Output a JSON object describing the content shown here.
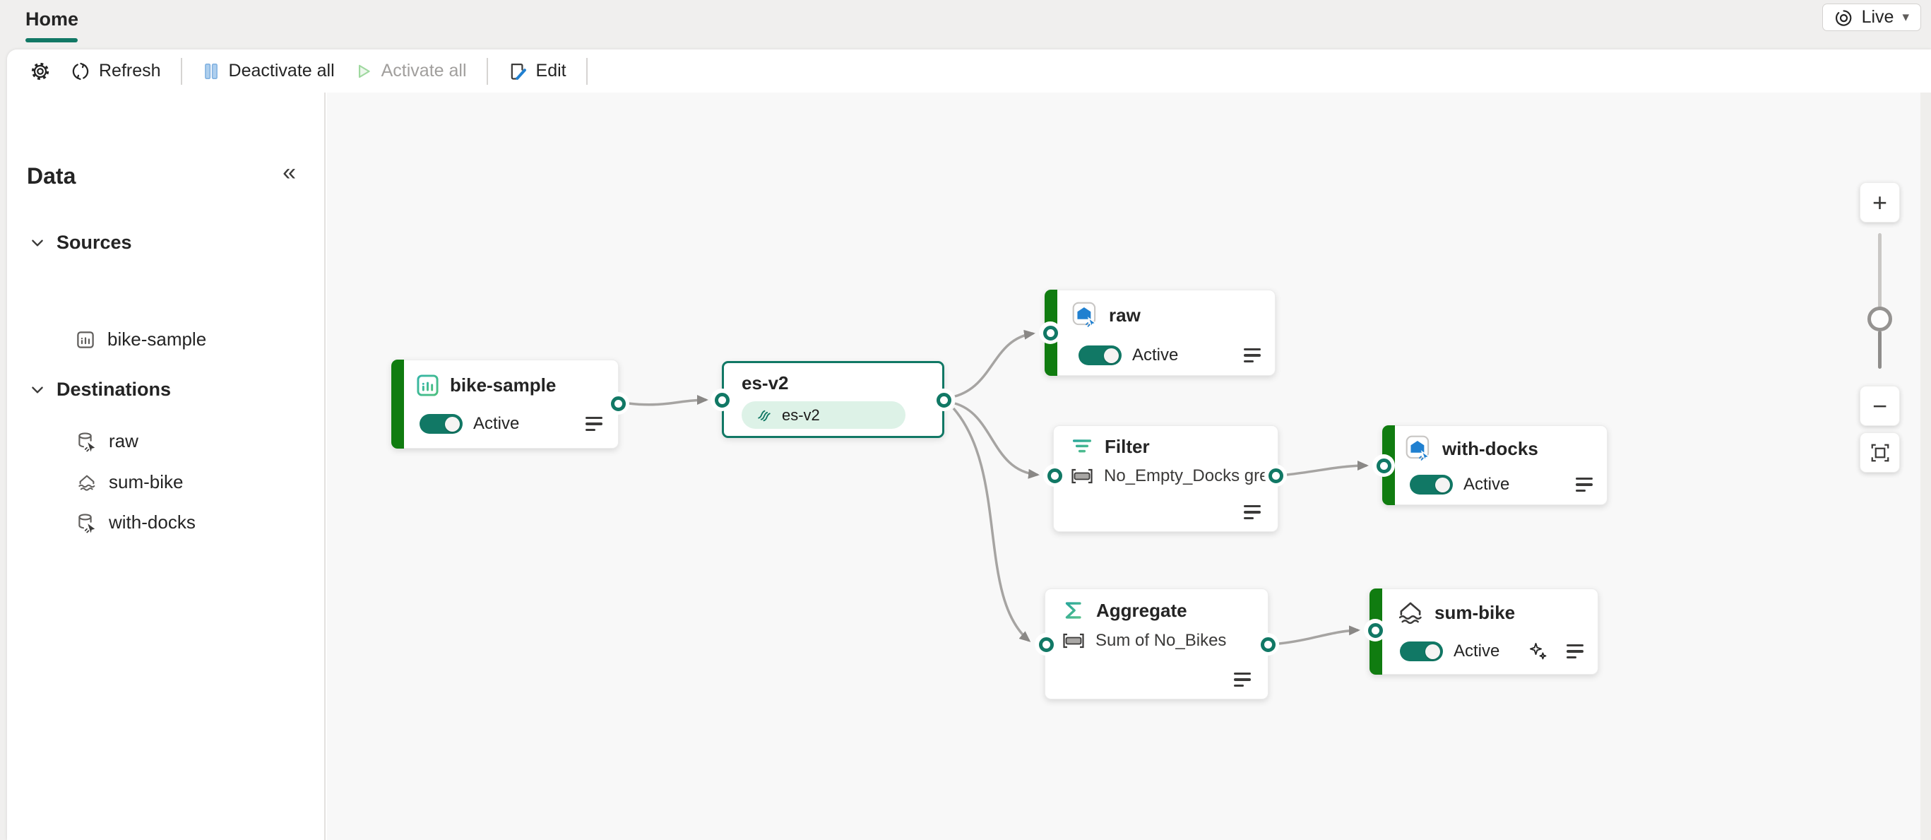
{
  "header": {
    "tab_home": "Home",
    "live_label": "Live"
  },
  "toolbar": {
    "refresh_label": "Refresh",
    "deactivate_all_label": "Deactivate all",
    "activate_all_label": "Activate all",
    "edit_label": "Edit"
  },
  "sidebar": {
    "title": "Data",
    "sources_label": "Sources",
    "destinations_label": "Destinations",
    "source_items": [
      {
        "label": "bike-sample"
      }
    ],
    "destination_items": [
      {
        "label": "raw"
      },
      {
        "label": "sum-bike"
      },
      {
        "label": "with-docks"
      }
    ]
  },
  "nodes": {
    "bike_sample": {
      "title": "bike-sample",
      "status": "Active"
    },
    "es_v2": {
      "title": "es-v2",
      "stream_label": "es-v2"
    },
    "raw": {
      "title": "raw",
      "status": "Active"
    },
    "filter": {
      "title": "Filter",
      "condition": "No_Empty_Docks greater t..."
    },
    "with_docks": {
      "title": "with-docks",
      "status": "Active"
    },
    "aggregate": {
      "title": "Aggregate",
      "operation": "Sum of No_Bikes"
    },
    "sum_bike": {
      "title": "sum-bike",
      "status": "Active"
    }
  },
  "icons": {
    "zoom_in": "+",
    "zoom_out": "−",
    "collapse": "«",
    "caret_down": "▾"
  },
  "colors": {
    "accent_teal": "#117865",
    "node_active_green": "#107c10",
    "selected_border": "#117865",
    "edge_gray": "#a6a4a2",
    "eventhouse_blue": "#2080d0",
    "pill_mint": "#ddf2e7",
    "pause_icon_blue": "#aecfee",
    "play_icon_green": "#9fd89f"
  }
}
